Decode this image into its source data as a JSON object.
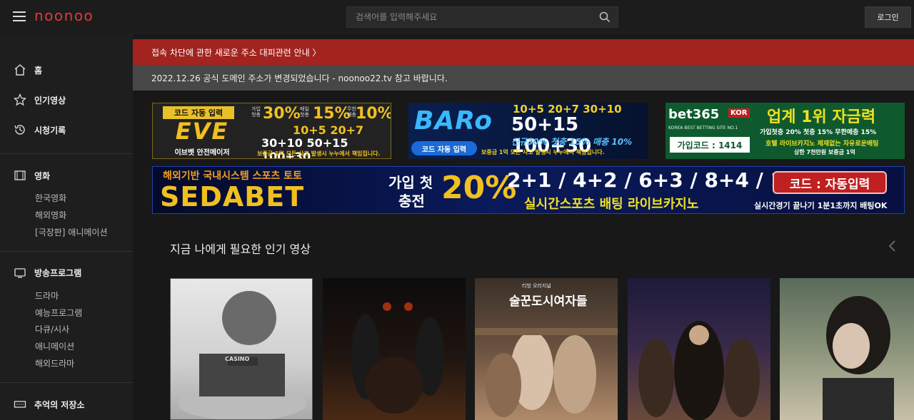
{
  "header": {
    "logo": "noonoo",
    "search_placeholder": "검색어를 입력해주세요",
    "login_label": "로그인"
  },
  "sidebar": {
    "home": "홈",
    "popular": "인기영상",
    "history": "시청기록",
    "movies": {
      "title": "영화",
      "items": [
        "한국영화",
        "해외영화",
        "[극장판] 애니메이션"
      ]
    },
    "broadcast": {
      "title": "방송프로그램",
      "items": [
        "드라마",
        "예능프로그램",
        "다큐/시사",
        "애니메이션",
        "해외드라마"
      ]
    },
    "archive": "추억의 저장소"
  },
  "notices": {
    "red": "접속 차단에 관한 새로운 주소 대피관련 안내 〉",
    "gray": "2022.12.26 공식 도메인 주소가 변경되었습니다 - noonoo22.tv 참고 바랍니다."
  },
  "ads": {
    "eve": {
      "badge": "코드 자동 입력",
      "brand": "EVE",
      "sub": "이브벳 안전메이저",
      "line1a": "가입 첫충",
      "pct1": "30%",
      "line1b": "매일 첫충",
      "pct2": "15%",
      "line1c": "무한 매충",
      "pct3": "10%",
      "line2": "10+5  20+7",
      "line3": "30+10  50+15  100+30",
      "footer": "보증금 1억  모든 사고 발생시 누누에서 책임집니다."
    },
    "baro": {
      "brand": "BARo",
      "badge": "코드 자동 입력",
      "line1": "10+5  20+7  30+10",
      "line2": "50+15  100+30",
      "line3": "신규30% 첫충 15% 매충 10%",
      "footer": "보증금 1억  모든 사고 발생시 누누에서 책임집니다."
    },
    "bet365": {
      "brand": "bet365",
      "kor": "KOR",
      "headline": "업계 1위 자금력",
      "tagline": "KOREA BEST BETTING SITE NO.1",
      "code": "가입코드 : 1414",
      "line1": "가입첫충 20% 첫충 15% 무한매충 15%",
      "line2": "호텔 라이브카지노 제재없는 자유로운배팅",
      "line3": "상한 7천만원 보증금 1억"
    },
    "seda": {
      "top": "해외기반 국내시스템 스포츠 토토",
      "brand": "SEDABET",
      "join": "가입 첫",
      "join2": "충전",
      "pct": "20%",
      "odds": "2+1 / 4+2 / 6+3 / 8+4 / 10+5",
      "live": "실시간스포츠 배팅 라이브카지노",
      "code": "코드 : 자동입력",
      "footer": "실시간경기 끝나기 1분1초까지 배팅OK"
    }
  },
  "section": {
    "title": "지금 나에게 필요한 인기 영상"
  },
  "posters": [
    {
      "title": "CASINO",
      "subtitle": ""
    },
    {
      "title": "",
      "subtitle": ""
    },
    {
      "title": "술꾼도시여자들",
      "subtitle": "티빙 오리지널"
    },
    {
      "title": "",
      "subtitle": ""
    },
    {
      "title": "",
      "subtitle": ""
    }
  ],
  "colors": {
    "accent_red": "#a3231f",
    "logo_red": "#e03a3a",
    "notice_gray": "#474747"
  }
}
